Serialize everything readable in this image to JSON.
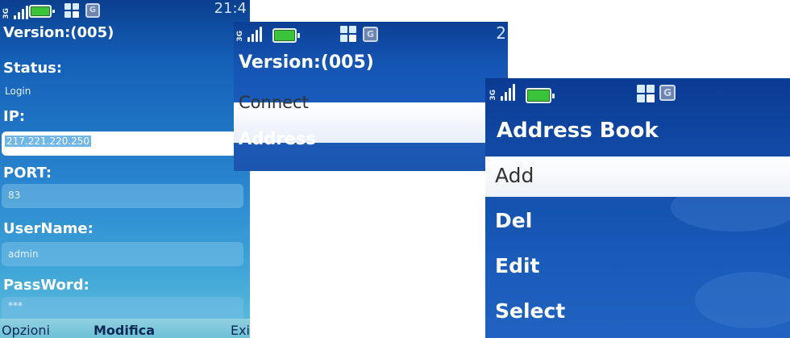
{
  "screen_login": {
    "status_bar": {
      "network": "3G",
      "clock": "21:4",
      "data_icon": "G"
    },
    "title": "Version:(005)",
    "fields": {
      "status_label": "Status:",
      "status_value": "Login",
      "ip_label": "IP:",
      "ip_value": "217.221.220.250",
      "port_label": "PORT:",
      "port_value": "83",
      "username_label": "UserName:",
      "username_value": "admin",
      "password_label": "PassWord:",
      "password_value": "***"
    },
    "softkeys": {
      "left": "Opzioni",
      "center": "Modifica",
      "right": "Exi"
    }
  },
  "screen_menu": {
    "status_bar": {
      "network": "3G",
      "clock": "2",
      "data_icon": "G"
    },
    "title": "Version:(005)",
    "items": [
      {
        "label": "Connect",
        "selected": true
      },
      {
        "label": "Address",
        "selected": false
      }
    ]
  },
  "screen_address_book": {
    "status_bar": {
      "network": "3G",
      "data_icon": "G"
    },
    "title": "Address Book",
    "items": [
      {
        "label": "Add",
        "selected": true
      },
      {
        "label": "Del",
        "selected": false
      },
      {
        "label": "Edit",
        "selected": false
      },
      {
        "label": "Select",
        "selected": false
      }
    ]
  },
  "colors": {
    "theme_dark_blue": "#0b3f8e",
    "theme_blue": "#1a5ab8",
    "highlight": "#ffffff",
    "battery": "#3ac43a",
    "selected_text": "#333333",
    "ip_highlight": "#6fb7e8"
  },
  "icons": [
    "signal-icon",
    "battery-icon",
    "windows-icon",
    "gprs-icon"
  ]
}
